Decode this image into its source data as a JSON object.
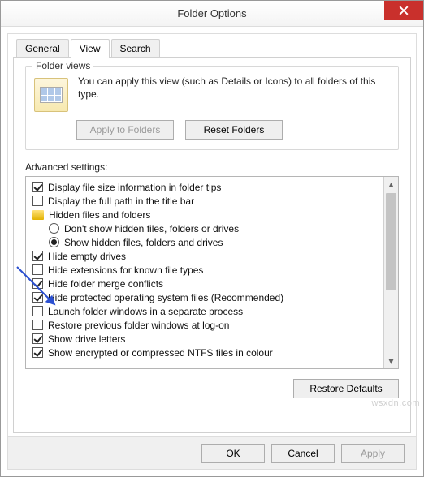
{
  "window": {
    "title": "Folder Options"
  },
  "tabs": {
    "general": "General",
    "view": "View",
    "search": "Search"
  },
  "folder_views": {
    "legend": "Folder views",
    "description": "You can apply this view (such as Details or Icons) to all folders of this type.",
    "apply_btn": "Apply to Folders",
    "reset_btn": "Reset Folders"
  },
  "advanced": {
    "label": "Advanced settings:",
    "items": [
      {
        "type": "check",
        "checked": true,
        "label": "Display file size information in folder tips"
      },
      {
        "type": "check",
        "checked": false,
        "label": "Display the full path in the title bar"
      },
      {
        "type": "folder",
        "label": "Hidden files and folders"
      },
      {
        "type": "radio",
        "checked": false,
        "indent": true,
        "label": "Don't show hidden files, folders or drives"
      },
      {
        "type": "radio",
        "checked": true,
        "indent": true,
        "label": "Show hidden files, folders and drives"
      },
      {
        "type": "check",
        "checked": true,
        "label": "Hide empty drives"
      },
      {
        "type": "check",
        "checked": false,
        "label": "Hide extensions for known file types"
      },
      {
        "type": "check",
        "checked": true,
        "label": "Hide folder merge conflicts"
      },
      {
        "type": "check",
        "checked": true,
        "label": "Hide protected operating system files (Recommended)"
      },
      {
        "type": "check",
        "checked": false,
        "label": "Launch folder windows in a separate process"
      },
      {
        "type": "check",
        "checked": false,
        "label": "Restore previous folder windows at log-on"
      },
      {
        "type": "check",
        "checked": true,
        "label": "Show drive letters"
      },
      {
        "type": "check",
        "checked": true,
        "label": "Show encrypted or compressed NTFS files in colour"
      }
    ],
    "restore_btn": "Restore Defaults"
  },
  "buttons": {
    "ok": "OK",
    "cancel": "Cancel",
    "apply": "Apply"
  },
  "watermark": "wsxdn.com"
}
